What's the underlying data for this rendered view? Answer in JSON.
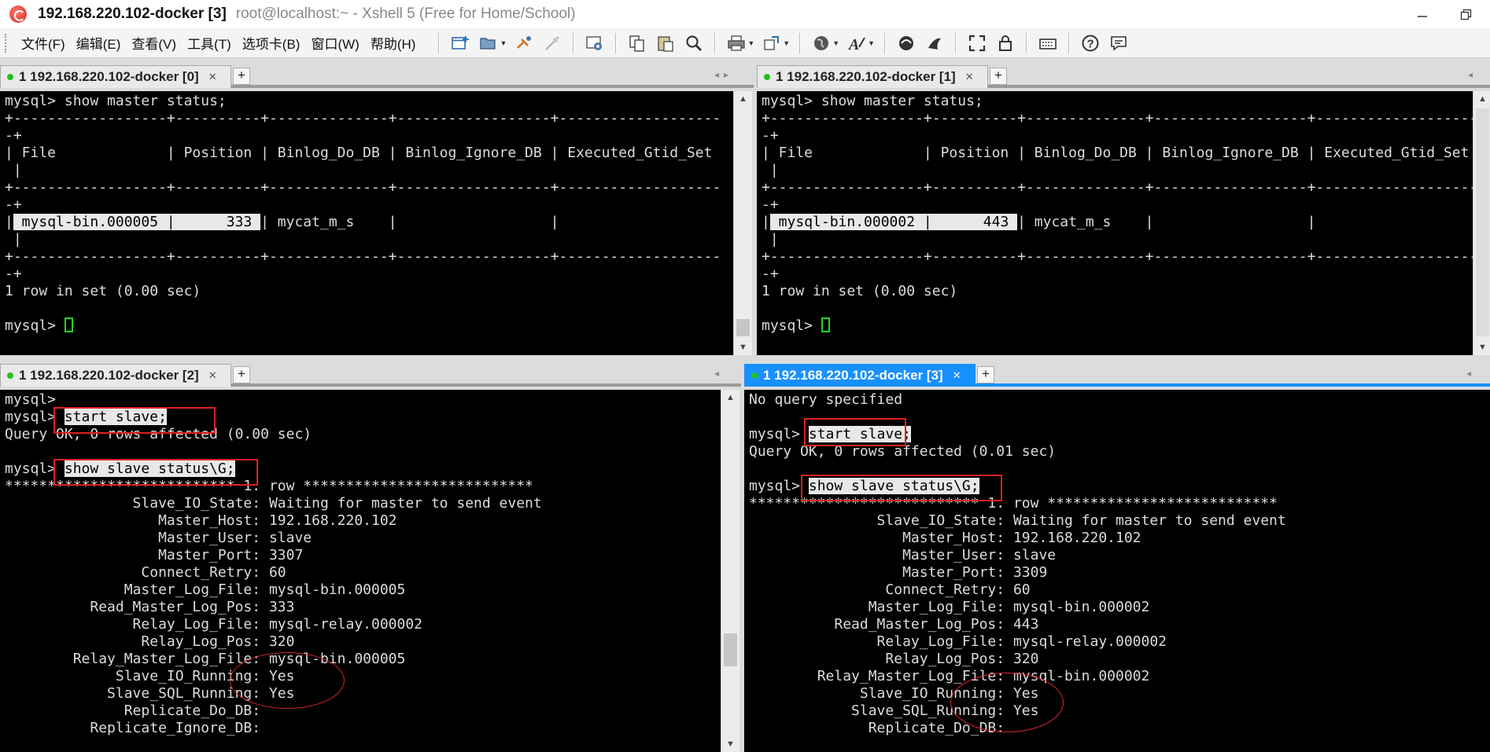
{
  "window": {
    "title_main": "192.168.220.102-docker [3]",
    "title_sub": "root@localhost:~ - Xshell 5 (Free for Home/School)"
  },
  "menu": [
    "文件(F)",
    "编辑(E)",
    "查看(V)",
    "工具(T)",
    "选项卡(B)",
    "窗口(W)",
    "帮助(H)"
  ],
  "toolbar_icons": [
    "new-session-icon",
    "open-folder-icon",
    "reconnect-icon",
    "disconnect-icon",
    "properties-icon",
    "copy-icon",
    "paste-icon",
    "find-icon",
    "print-icon",
    "transfer-icon",
    "globe-icon",
    "font-icon",
    "xftp-icon",
    "xagent-icon",
    "fullscreen-icon",
    "lock-icon",
    "keyboard-icon",
    "help-icon",
    "chat-icon"
  ],
  "panes": [
    {
      "tab_label": "1 192.168.220.102-docker [0]",
      "lines": [
        "mysql> show master status;",
        "+------------------+----------+--------------+------------------+-------------------",
        "-+",
        "| File             | Position | Binlog_Do_DB | Binlog_Ignore_DB | Executed_Gtid_Set",
        " |",
        "+------------------+----------+--------------+------------------+-------------------",
        "-+",
        "| mysql-bin.000005 |      333 | mycat_m_s    |                  |",
        " |",
        "+------------------+----------+--------------+------------------+-------------------",
        "-+",
        "1 row in set (0.00 sec)",
        "",
        "mysql> "
      ]
    },
    {
      "tab_label": "1 192.168.220.102-docker [1]",
      "lines": [
        "mysql> show master status;",
        "+------------------+----------+--------------+------------------+-------------------",
        "-+",
        "| File             | Position | Binlog_Do_DB | Binlog_Ignore_DB | Executed_Gtid_Set",
        " |",
        "+------------------+----------+--------------+------------------+-------------------",
        "-+",
        "| mysql-bin.000002 |      443 | mycat_m_s    |                  |",
        " |",
        "+------------------+----------+--------------+------------------+-------------------",
        "-+",
        "1 row in set (0.00 sec)",
        "",
        "mysql> "
      ]
    },
    {
      "tab_label": "1 192.168.220.102-docker [2]",
      "lines": [
        "mysql>",
        "mysql> start slave;",
        "Query OK, 0 rows affected (0.00 sec)",
        "",
        "mysql> show slave status\\G;",
        "*************************** 1. row ***************************",
        "               Slave_IO_State: Waiting for master to send event",
        "                  Master_Host: 192.168.220.102",
        "                  Master_User: slave",
        "                  Master_Port: 3307",
        "                Connect_Retry: 60",
        "              Master_Log_File: mysql-bin.000005",
        "          Read_Master_Log_Pos: 333",
        "               Relay_Log_File: mysql-relay.000002",
        "                Relay_Log_Pos: 320",
        "        Relay_Master_Log_File: mysql-bin.000005",
        "             Slave_IO_Running: Yes",
        "            Slave_SQL_Running: Yes",
        "              Replicate_Do_DB:",
        "          Replicate_Ignore_DB:"
      ]
    },
    {
      "tab_label": "1 192.168.220.102-docker [3]",
      "lines": [
        "No query specified",
        "",
        "mysql> start slave;",
        "Query OK, 0 rows affected (0.01 sec)",
        "",
        "mysql> show slave status\\G;",
        "*************************** 1. row ***************************",
        "               Slave_IO_State: Waiting for master to send event",
        "                  Master_Host: 192.168.220.102",
        "                  Master_User: slave",
        "                  Master_Port: 3309",
        "                Connect_Retry: 60",
        "              Master_Log_File: mysql-bin.000002",
        "          Read_Master_Log_Pos: 443",
        "               Relay_Log_File: mysql-relay.000002",
        "                Relay_Log_Pos: 320",
        "        Relay_Master_Log_File: mysql-bin.000002",
        "             Slave_IO_Running: Yes",
        "            Slave_SQL_Running: Yes",
        "              Replicate_Do_DB:"
      ]
    }
  ],
  "colors": {
    "terminal_bg": "#000000",
    "terminal_fg": "#dcdcdc",
    "active_tab": "#1890ff",
    "annotation": "#e02020",
    "cursor": "#1fd61f"
  }
}
